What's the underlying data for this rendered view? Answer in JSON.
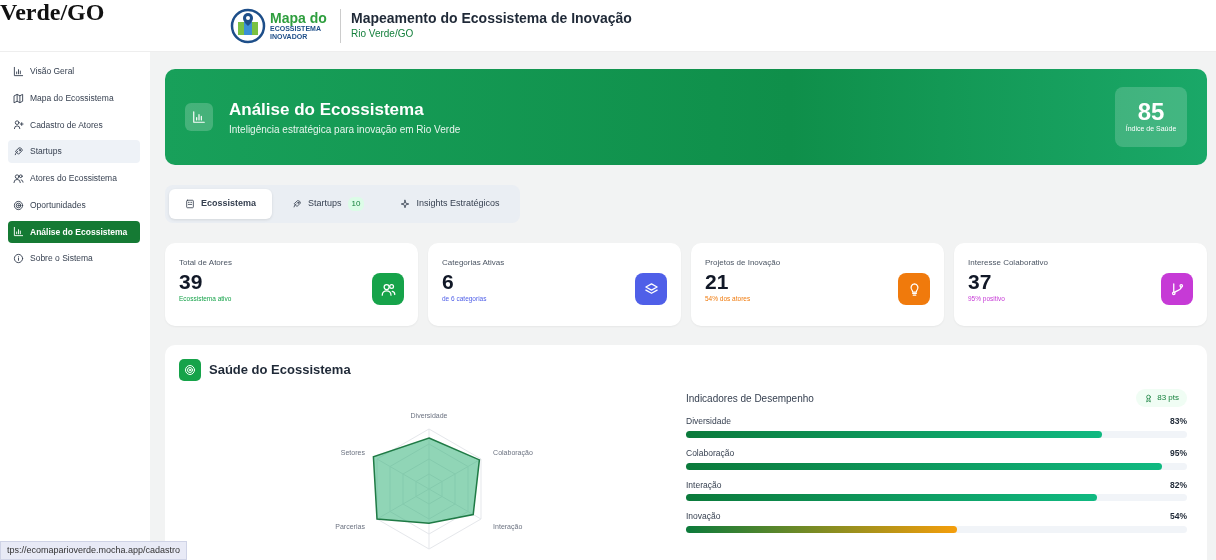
{
  "overlay_title": "Verde/GO",
  "header": {
    "logo_text": "Mapa do",
    "logo_sub": "ECOSSISTEMA INOVADOR",
    "title": "Mapeamento do Ecossistema de Inovação",
    "subtitle": "Rio Verde/GO"
  },
  "sidebar": {
    "items": [
      {
        "label": "Visão Geral",
        "selected": false,
        "hover": false
      },
      {
        "label": "Mapa do Ecossistema",
        "selected": false,
        "hover": false
      },
      {
        "label": "Cadastro de Atores",
        "selected": false,
        "hover": false
      },
      {
        "label": "Startups",
        "selected": false,
        "hover": true
      },
      {
        "label": "Atores do Ecossistema",
        "selected": false,
        "hover": false
      },
      {
        "label": "Oportunidades",
        "selected": false,
        "hover": false
      },
      {
        "label": "Análise do Ecossistema",
        "selected": true,
        "hover": false
      },
      {
        "label": "Sobre o Sistema",
        "selected": false,
        "hover": false
      }
    ]
  },
  "hero": {
    "title": "Análise do Ecossistema",
    "subtitle": "Inteligência estratégica para inovação em Rio Verde",
    "score": "85",
    "score_label": "Índice de Saúde"
  },
  "tabs": [
    {
      "label": "Ecossistema",
      "selected": true
    },
    {
      "label": "Startups",
      "badge": "10",
      "selected": false
    },
    {
      "label": "Insights Estratégicos",
      "selected": false
    }
  ],
  "stats": [
    {
      "label": "Total de Atores",
      "value": "39",
      "note": "Ecossistema ativo",
      "color": "#16a34a"
    },
    {
      "label": "Categorias Ativas",
      "value": "6",
      "note": "de 6 categorias",
      "color": "#4f5fe8"
    },
    {
      "label": "Projetos de Inovação",
      "value": "21",
      "note": "54% dos atores",
      "color": "#f07a0c"
    },
    {
      "label": "Interesse Colaborativo",
      "value": "37",
      "note": "95% positivo",
      "color": "#c63ad6"
    }
  ],
  "health": {
    "title": "Saúde do Ecossistema",
    "radar_labels": [
      "Diversidade",
      "Colaboração",
      "Interação",
      "Parcerias",
      "Setores"
    ],
    "indicators_title": "Indicadores de Desempenho",
    "points": "83 pts",
    "indicators": [
      {
        "label": "Diversidade",
        "reading": "83%",
        "level": 0.83,
        "kind": "good"
      },
      {
        "label": "Colaboração",
        "reading": "95%",
        "level": 0.95,
        "kind": "good"
      },
      {
        "label": "Interação",
        "reading": "82%",
        "level": 0.82,
        "kind": "good"
      },
      {
        "label": "Inovação",
        "reading": "54%",
        "level": 0.54,
        "kind": "warning"
      }
    ]
  },
  "status_url": "tps://ecomaparioverde.mocha.app/cadastro"
}
